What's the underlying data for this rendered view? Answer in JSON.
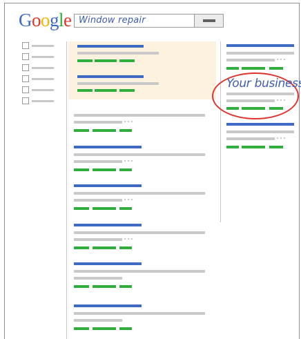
{
  "header": {
    "logo": {
      "letters": [
        {
          "char": "G",
          "color": "#3e6ac6"
        },
        {
          "char": "o",
          "color": "#e0332d"
        },
        {
          "char": "o",
          "color": "#f4b400"
        },
        {
          "char": "g",
          "color": "#3e6ac6"
        },
        {
          "char": "l",
          "color": "#2fae3d"
        },
        {
          "char": "e",
          "color": "#e0332d"
        }
      ]
    },
    "search": {
      "query": "Window repair",
      "button_icon": "search-bar-icon"
    }
  },
  "right_column": {
    "highlight_label": "Your business",
    "highlight_color": "#e0332d"
  },
  "colors": {
    "title": "#3e6ac6",
    "url": "#2fae3d",
    "snippet": "#c9c9c9",
    "ads_background": "#fdf1e0"
  }
}
